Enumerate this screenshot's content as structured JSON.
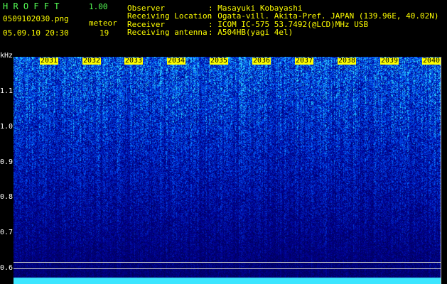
{
  "header": {
    "app_title": "H R O F F T",
    "version": "1.00",
    "filename": "0509102030.png",
    "mode_label": "meteor",
    "datetime": "05.09.10 20:30",
    "count": "19",
    "fields": [
      {
        "label": "Observer",
        "value": ": Masayuki Kobayashi"
      },
      {
        "label": "Receiving Location",
        "value": ": Ogata-vill. Akita-Pref. JAPAN (139.96E, 40.02N)"
      },
      {
        "label": "Receiver",
        "value": ": ICOM IC-575 53.7492(@LCD)MHz USB"
      },
      {
        "label": "Receiving antenna",
        "value": ": A504HB(yagi 4el)"
      }
    ]
  },
  "axis": {
    "y_unit": "kHz",
    "y_ticks": [
      "1.1",
      "1.0",
      "0.9",
      "0.8",
      "0.7",
      "0.6"
    ],
    "x_ticks": [
      "2031",
      "2032",
      "2033",
      "2034",
      "2035",
      "2036",
      "2037",
      "2038",
      "2039",
      "2040"
    ]
  },
  "colors": {
    "background": "#000000",
    "header_green": "#55ff55",
    "header_yellow": "#ffff00",
    "spectrogram_low": "#00006e",
    "spectrogram_high": "#40ffff"
  }
}
